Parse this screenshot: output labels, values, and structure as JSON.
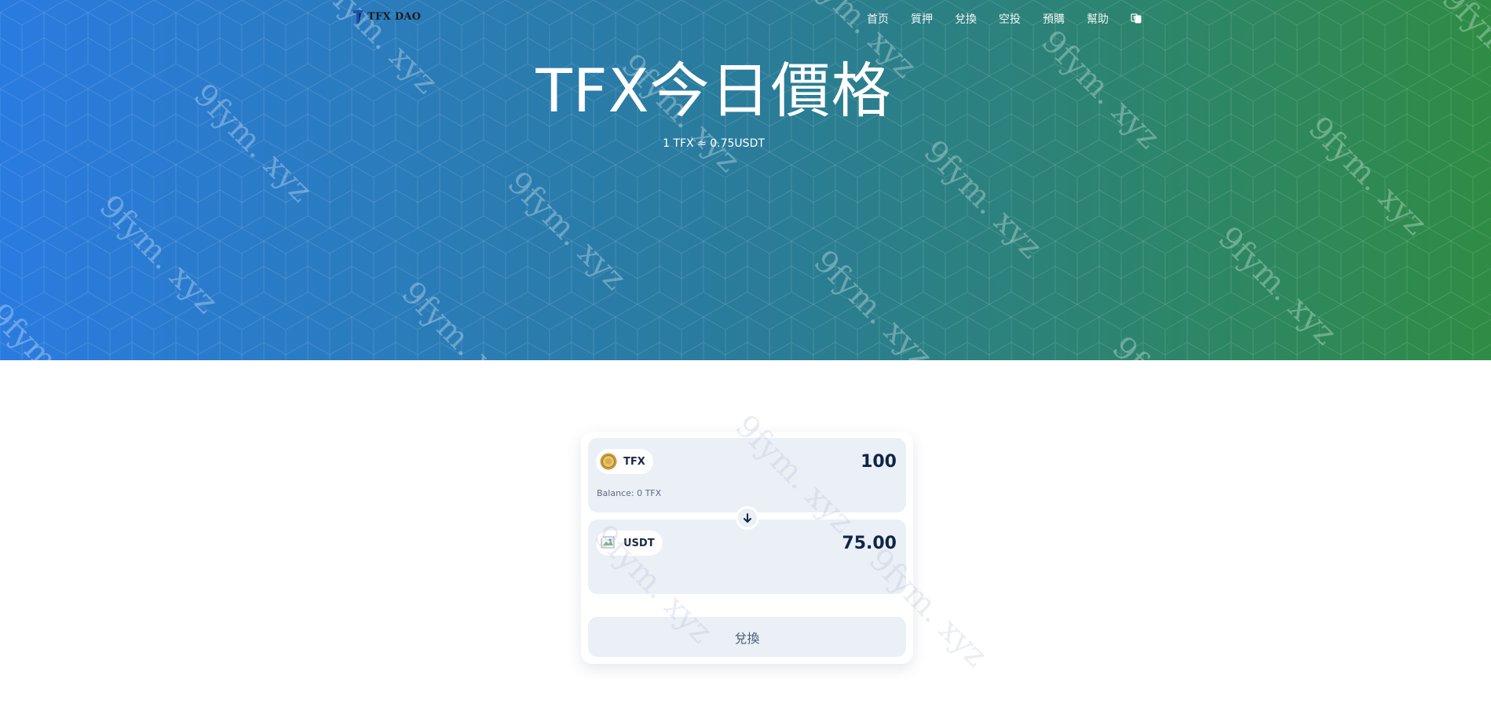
{
  "header": {
    "logo_text": "TFX DAO",
    "nav": [
      {
        "label": "首页"
      },
      {
        "label": "質押"
      },
      {
        "label": "兌換"
      },
      {
        "label": "空投"
      },
      {
        "label": "預購"
      },
      {
        "label": "幫助"
      }
    ],
    "language_icon": "language-icon"
  },
  "hero": {
    "title": "TFX今日價格",
    "rate": "1 TFX ≈ 0.75USDT",
    "gradient": {
      "start": "#2a7be0",
      "end": "#2f8c45"
    }
  },
  "swap": {
    "from": {
      "symbol": "TFX",
      "amount": "100",
      "balance": "Balance: 0 TFX"
    },
    "to": {
      "symbol": "USDT",
      "amount": "75.00"
    },
    "switch_icon": "arrow-down-icon",
    "button_label": "兌換"
  },
  "watermark": {
    "text": "9fym. xyz"
  }
}
